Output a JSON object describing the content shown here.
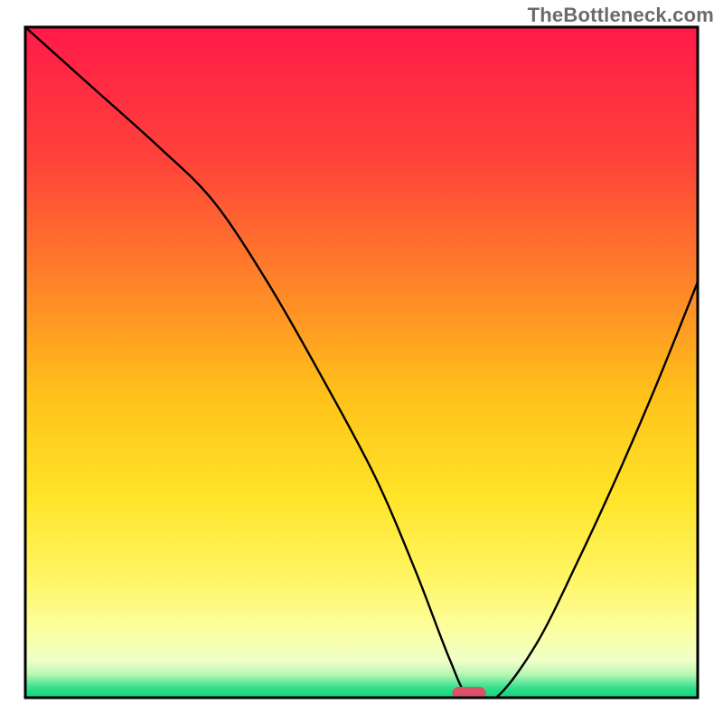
{
  "watermark": "TheBottleneck.com",
  "chart_data": {
    "type": "line",
    "title": "",
    "xlabel": "",
    "ylabel": "",
    "xlim": [
      0,
      100
    ],
    "ylim": [
      0,
      100
    ],
    "optimal_x": 66,
    "optimal_width": 5,
    "series": [
      {
        "name": "bottleneck-curve",
        "x": [
          0,
          10,
          20,
          28,
          36,
          44,
          52,
          58,
          63,
          66,
          70,
          76,
          82,
          88,
          94,
          100
        ],
        "y": [
          100,
          91,
          82,
          74,
          62,
          48,
          33,
          19,
          6,
          0,
          0,
          8,
          20,
          33,
          47,
          62
        ]
      }
    ],
    "gradient_stops": [
      {
        "offset": 0,
        "color": "#ff1a49"
      },
      {
        "offset": 0.2,
        "color": "#ff4339"
      },
      {
        "offset": 0.4,
        "color": "#ff8a27"
      },
      {
        "offset": 0.55,
        "color": "#ffc21a"
      },
      {
        "offset": 0.7,
        "color": "#ffe428"
      },
      {
        "offset": 0.82,
        "color": "#fff563"
      },
      {
        "offset": 0.9,
        "color": "#fcffa0"
      },
      {
        "offset": 0.945,
        "color": "#efffc8"
      },
      {
        "offset": 0.965,
        "color": "#b8f7b3"
      },
      {
        "offset": 0.985,
        "color": "#33e08e"
      },
      {
        "offset": 1.0,
        "color": "#13d27b"
      }
    ],
    "marker_color": "#d9526a",
    "frame_color": "#000000",
    "curve_color": "#000000"
  }
}
